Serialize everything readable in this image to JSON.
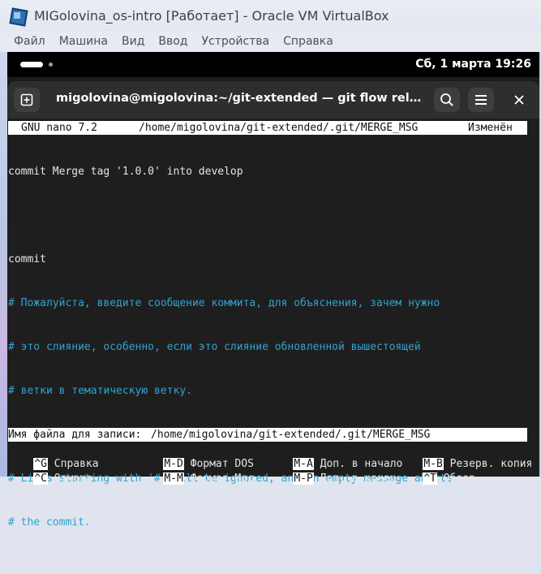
{
  "host_window": {
    "title": "MIGolovina_os-intro [Работает] - Oracle VM VirtualBox",
    "menu": [
      "Файл",
      "Машина",
      "Вид",
      "Ввод",
      "Устройства",
      "Справка"
    ]
  },
  "gnome_bar": {
    "clock": "Сб, 1 марта  19:26"
  },
  "terminal": {
    "title": "migolovina@migolovina:~/git-extended — git flow release finis…"
  },
  "nano": {
    "version": "GNU nano 7.2",
    "path": "/home/migolovina/git-extended/.git/MERGE_MSG",
    "state": "Изменён",
    "lines": [
      {
        "text": "commit Merge tag '1.0.0' into develop",
        "type": "normal"
      },
      {
        "text": "",
        "type": "normal"
      },
      {
        "text": "commit",
        "type": "normal"
      },
      {
        "text": "# Пожалуйста, введите сообщение коммита, для объяснения, зачем нужно",
        "type": "comment"
      },
      {
        "text": "# это слияние, особенно, если это слияние обновленной вышестоящей",
        "type": "comment"
      },
      {
        "text": "# ветки в тематическую ветку.",
        "type": "comment"
      },
      {
        "text": "#",
        "type": "comment"
      },
      {
        "text": "# Lines starting with '#' will be ignored, and an empty message aborts",
        "type": "comment"
      },
      {
        "text": "# the commit.",
        "type": "comment"
      }
    ],
    "prompt_label": "Имя файла для записи: ",
    "prompt_value": "/home/migolovina/git-extended/.git/MERGE_MSG",
    "shortcuts": [
      {
        "key": "^G",
        "label": "Справка"
      },
      {
        "key": "M-D",
        "label": "Формат DOS"
      },
      {
        "key": "M-A",
        "label": "Доп. в начало"
      },
      {
        "key": "M-B",
        "label": "Резерв. копия"
      },
      {
        "key": "^C",
        "label": "Отмена"
      },
      {
        "key": "M-M",
        "label": "Формат Mac"
      },
      {
        "key": "M-P",
        "label": "Доп. в конец"
      },
      {
        "key": "^T",
        "label": "Обзор"
      }
    ]
  },
  "colors": {
    "comment": "#31a3cf",
    "terminal_bg": "#1e1e1e",
    "header_bg": "#2e2e2e"
  }
}
